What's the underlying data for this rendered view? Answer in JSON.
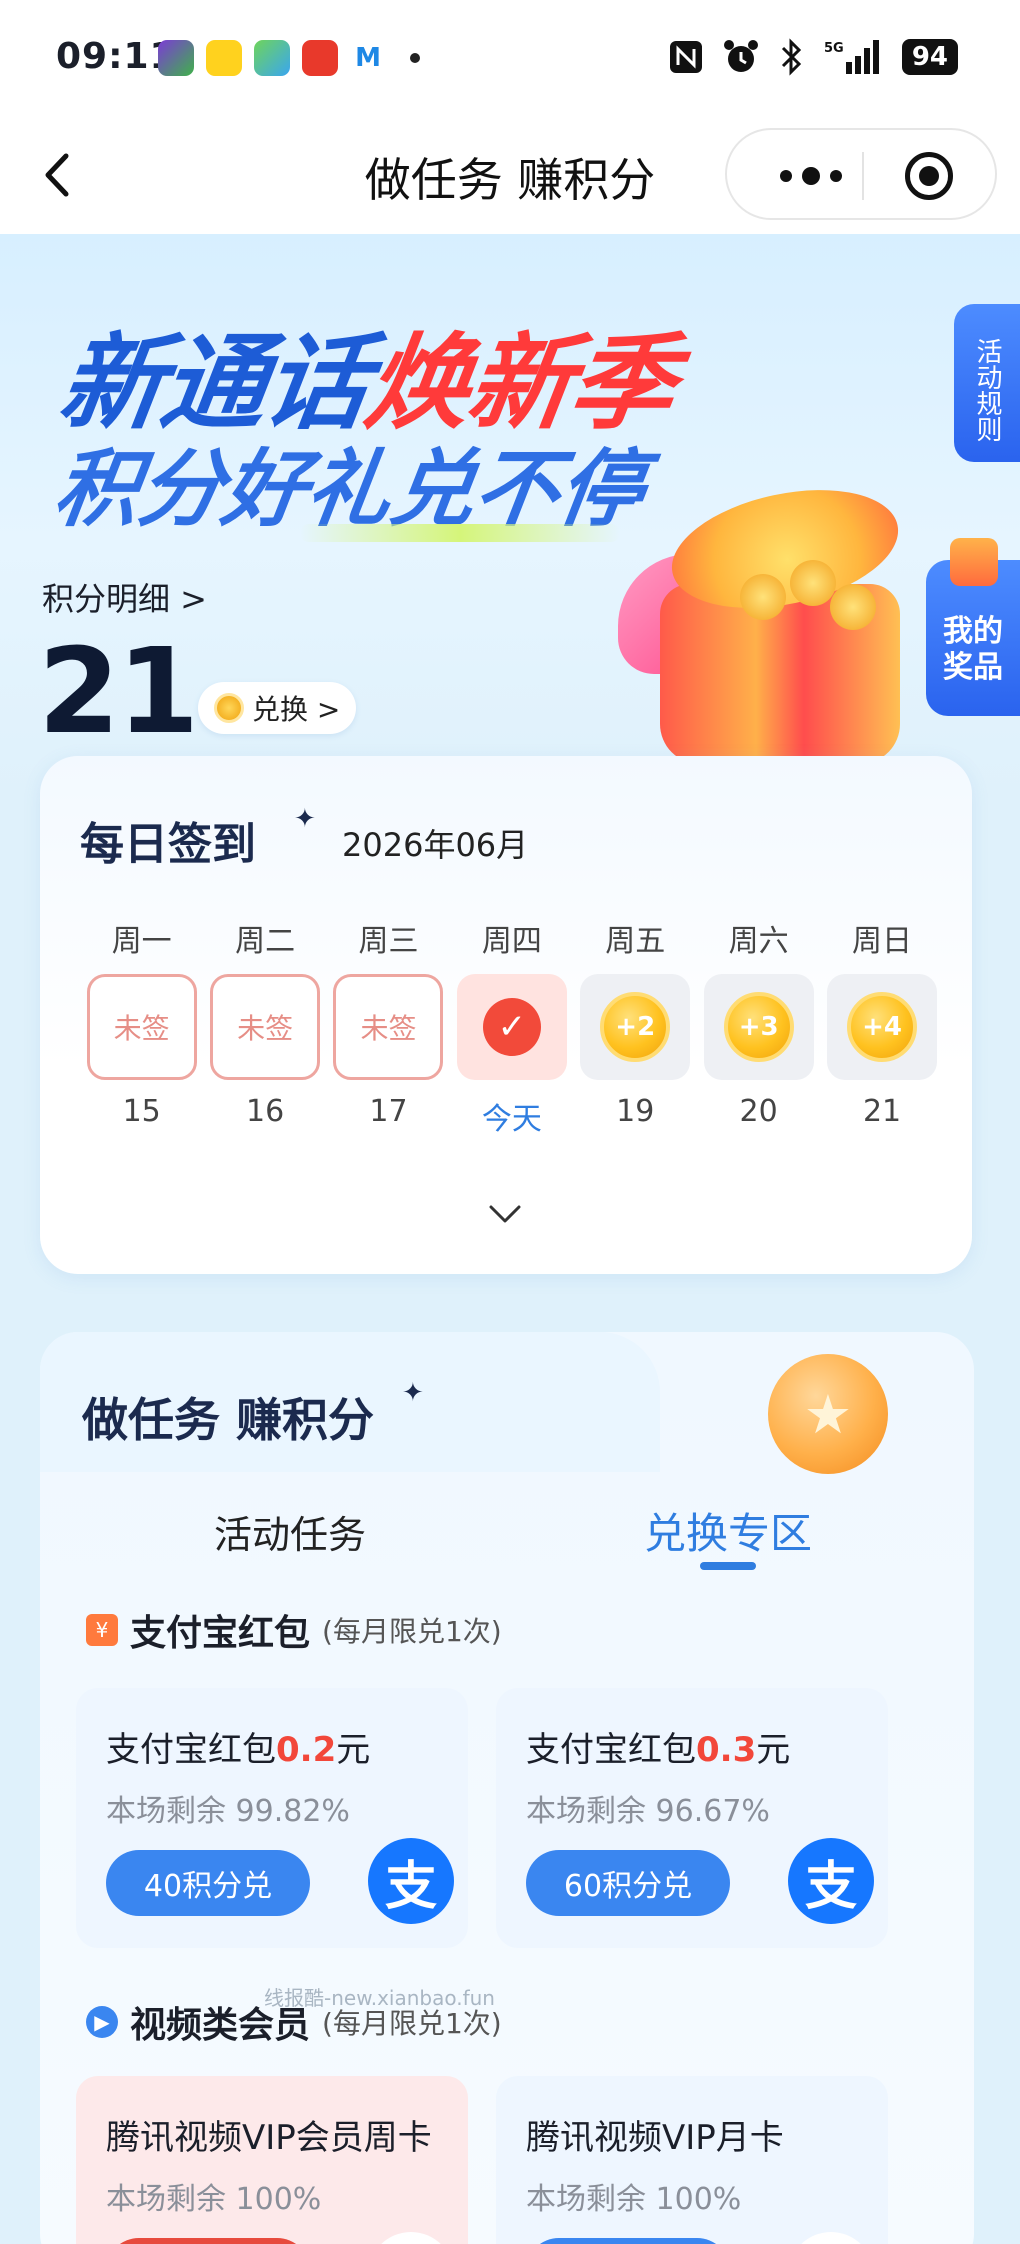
{
  "status_bar": {
    "time": "09:11",
    "battery": "94",
    "signal": "5G"
  },
  "nav": {
    "title": "做任务 赚积分"
  },
  "hero": {
    "line1_blue": "新通话",
    "line1_red": "焕新季",
    "line2": "积分好礼兑不停",
    "rules_label": "活动规则",
    "prize_label": "我的奖品"
  },
  "points": {
    "label": "积分明细 >",
    "value": "21",
    "exchange_label": "兑换 >"
  },
  "checkin": {
    "title": "每日签到",
    "month": "2026年06月",
    "weekdays": [
      "周一",
      "周二",
      "周三",
      "周四",
      "周五",
      "周六",
      "周日"
    ],
    "days": [
      {
        "state": "missed",
        "text": "未签",
        "label": "15"
      },
      {
        "state": "missed",
        "text": "未签",
        "label": "16"
      },
      {
        "state": "missed",
        "text": "未签",
        "label": "17"
      },
      {
        "state": "today",
        "text": "",
        "label": "今天"
      },
      {
        "state": "future",
        "text": "+2",
        "label": "19"
      },
      {
        "state": "future",
        "text": "+3",
        "label": "20"
      },
      {
        "state": "future",
        "text": "+4",
        "label": "21"
      }
    ]
  },
  "tasks": {
    "title": "做任务 赚积分",
    "tabs": [
      "活动任务",
      "兑换专区"
    ],
    "active_tab": 1,
    "sections": [
      {
        "title": "支付宝红包",
        "subtitle": "(每月限兑1次)",
        "items": [
          {
            "name_prefix": "支付宝红包",
            "amount": "0.2",
            "unit": "元",
            "remain": "本场剩余 99.82%",
            "button": "40积分兑"
          },
          {
            "name_prefix": "支付宝红包",
            "amount": "0.3",
            "unit": "元",
            "remain": "本场剩余 96.67%",
            "button": "60积分兑"
          }
        ]
      },
      {
        "title": "视频类会员",
        "subtitle": "(每月限兑1次)",
        "items": [
          {
            "name": "腾讯视频VIP会员周卡",
            "remain": "本场剩余 100%"
          },
          {
            "name": "腾讯视频VIP月卡",
            "remain": "本场剩余 100%"
          }
        ]
      }
    ]
  },
  "watermark": "线报酷-new.xianbao.fun",
  "colors": {
    "accent": "#2f7de0",
    "red": "#f2473a",
    "alipay": "#1677ff"
  }
}
